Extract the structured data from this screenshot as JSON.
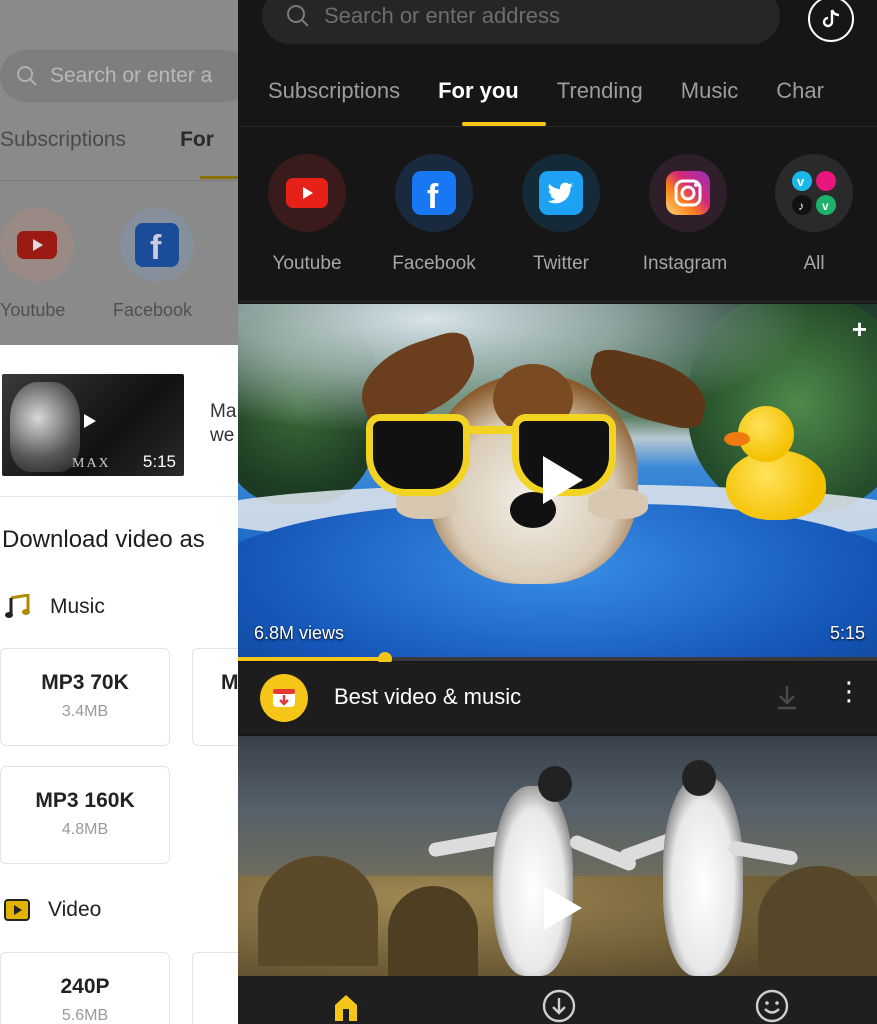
{
  "back": {
    "search": {
      "placeholder": "Search or enter a"
    },
    "tabs": [
      {
        "label": "Subscriptions"
      },
      {
        "label": "For"
      }
    ],
    "platforms": [
      {
        "label": "Youtube"
      },
      {
        "label": "Facebook"
      }
    ],
    "video": {
      "duration": "5:15",
      "overlay_text": "MAX",
      "text_line1": "Ma",
      "text_line2": "we"
    },
    "download_title": "Download video as",
    "music": {
      "label": "Music",
      "options": [
        {
          "quality": "MP3 70K",
          "size": "3.4MB"
        },
        {
          "quality": "MP3 160K",
          "size": "4.8MB"
        }
      ],
      "partial_label": "M"
    },
    "video_section": {
      "label": "Video",
      "options": [
        {
          "quality": "240P",
          "size": "5.6MB"
        }
      ]
    }
  },
  "front": {
    "search": {
      "placeholder": "Search or enter address"
    },
    "tabs": [
      {
        "label": "Subscriptions"
      },
      {
        "label": "For you"
      },
      {
        "label": "Trending"
      },
      {
        "label": "Music"
      },
      {
        "label": "Char"
      }
    ],
    "active_tab": "For you",
    "platforms": [
      {
        "label": "Youtube",
        "icon": "youtube-icon"
      },
      {
        "label": "Facebook",
        "icon": "facebook-icon"
      },
      {
        "label": "Twitter",
        "icon": "twitter-icon"
      },
      {
        "label": "Instagram",
        "icon": "instagram-icon"
      },
      {
        "label": "All",
        "icon": "all-apps-icon"
      }
    ],
    "video1": {
      "views": "6.8M views",
      "duration": "5:15",
      "progress": 0.23,
      "plus": "+"
    },
    "video_info": {
      "title": "Best video & music",
      "more": "⋮"
    },
    "nav": [
      {
        "icon": "home-icon"
      },
      {
        "icon": "download-icon"
      },
      {
        "icon": "me-icon"
      }
    ]
  },
  "colors": {
    "accent": "#f5c518",
    "dark_bg": "#161616",
    "youtube": "#e62117",
    "facebook": "#1877f2",
    "twitter": "#1da1f2"
  }
}
